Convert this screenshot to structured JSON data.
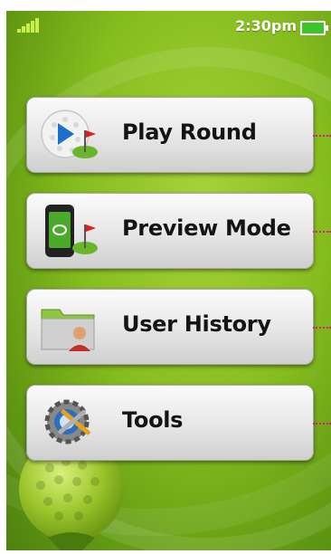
{
  "status_bar": {
    "time": "2:30pm"
  },
  "menu": [
    {
      "label": "Play Round",
      "icon": "golf-ball-flag-icon"
    },
    {
      "label": "Preview Mode",
      "icon": "phone-flag-icon"
    },
    {
      "label": "User History",
      "icon": "folder-user-icon"
    },
    {
      "label": "Tools",
      "icon": "gear-tools-icon"
    }
  ],
  "colors": {
    "background": "#86bd1e",
    "callout_dots": "#e2187d",
    "battery": "#3cc42d"
  }
}
